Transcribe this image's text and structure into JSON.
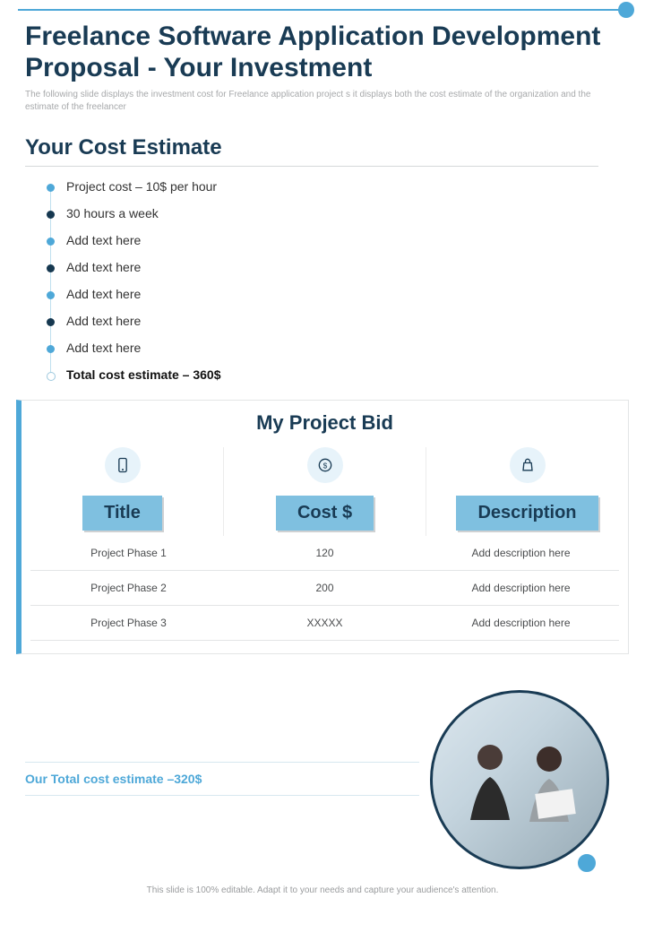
{
  "page": {
    "title": "Freelance Software Application Development Proposal - Your Investment",
    "subtitle": "The following slide displays the investment cost for Freelance application project s it displays both the cost estimate of the organization and the estimate of the freelancer"
  },
  "cost_estimate": {
    "heading": "Your Cost Estimate",
    "items": [
      "Project cost – 10$ per hour",
      "30 hours a week",
      "Add text here",
      "Add text here",
      "Add text here",
      "Add text here",
      "Add text here"
    ],
    "total": "Total cost estimate – 360$"
  },
  "bid": {
    "heading": "My Project Bid",
    "columns": [
      "Title",
      "Cost $",
      "Description"
    ],
    "rows": [
      {
        "title": "Project Phase 1",
        "cost": "120",
        "desc": "Add description here"
      },
      {
        "title": "Project Phase 2",
        "cost": "200",
        "desc": "Add description here"
      },
      {
        "title": "Project Phase 3",
        "cost": "XXXXX",
        "desc": "Add description here"
      }
    ]
  },
  "our_total": "Our Total cost estimate –320$",
  "footer": "This slide is 100% editable. Adapt it to your needs and capture your audience's attention."
}
